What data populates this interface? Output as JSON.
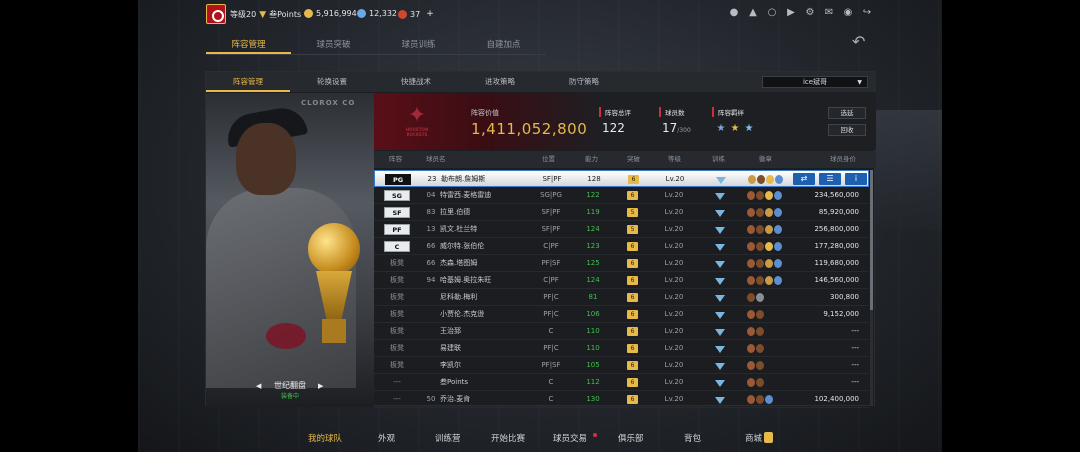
{
  "topbar": {
    "level": "等级20",
    "points_label": "叁Points",
    "gold": "5,916,994",
    "diamonds": "12,332",
    "tickets": "37",
    "plus": "+",
    "icons": [
      "person-icon",
      "bell-icon",
      "friends-icon",
      "video-icon",
      "settings-icon",
      "chat-icon",
      "headset-icon",
      "exit-icon"
    ]
  },
  "main_tabs": [
    "阵容管理",
    "球员突破",
    "球员训练",
    "自建加点"
  ],
  "sub_tabs": [
    "阵容管理",
    "轮换设置",
    "快捷战术",
    "进攻策略",
    "防守策略"
  ],
  "team_select": "ice斌哥",
  "card": {
    "name": "世纪翻盘",
    "status": "装备中",
    "watermark": "CLOROX CO"
  },
  "summary": {
    "value_label": "阵容价值",
    "value": "1,411,052,800",
    "rating_label": "阵容总评",
    "rating": "122",
    "count_label": "球员数",
    "count": "17",
    "count_max": "/300",
    "honor_label": "阵容羁绊",
    "select_button": "选延",
    "recycle_button": "回收",
    "team_logo_text": "HOUSTON ROCKETS"
  },
  "table": {
    "headers": {
      "lineup": "阵容",
      "player": "球员名",
      "position": "位置",
      "ability": "能力",
      "break": "突破",
      "level": "等级",
      "train": "训练",
      "badges": "徽章",
      "salary": "球员身价"
    },
    "rows": [
      {
        "pos": "PG",
        "num": "23",
        "name": "勒布朗.詹姆斯",
        "position": "SF|PF",
        "ability": "128",
        "brk": "6",
        "level": "Lv.20",
        "salary": "",
        "badges": [
          "#c99b45",
          "#7d4c2a",
          "#e6b94a",
          "#5b8fd1"
        ],
        "selected": true,
        "boxed": true
      },
      {
        "pos": "SG",
        "num": "04",
        "name": "特雷西.麦格雷迪",
        "position": "SG|PG",
        "ability": "122",
        "brk": "6",
        "level": "Lv.20",
        "salary": "234,560,000",
        "badges": [
          "#9a5a35",
          "#7d4c2a",
          "#e6b94a",
          "#5b8fd1"
        ],
        "selected": false,
        "boxed": true
      },
      {
        "pos": "SF",
        "num": "83",
        "name": "拉里.伯德",
        "position": "SF|PF",
        "ability": "119",
        "brk": "5",
        "level": "Lv.20",
        "salary": "85,920,000",
        "badges": [
          "#9a5a35",
          "#7d4c2a",
          "#c99b45",
          "#5b8fd1"
        ],
        "selected": false,
        "boxed": true
      },
      {
        "pos": "PF",
        "num": "13",
        "name": "凯文.杜兰特",
        "position": "SF|PF",
        "ability": "124",
        "brk": "5",
        "level": "Lv.20",
        "salary": "256,800,000",
        "badges": [
          "#9a5a35",
          "#7d4c2a",
          "#c99b45",
          "#5b8fd1"
        ],
        "selected": false,
        "boxed": true
      },
      {
        "pos": "C",
        "num": "66",
        "name": "威尔特.张伯伦",
        "position": "C|PF",
        "ability": "123",
        "brk": "6",
        "level": "Lv.20",
        "salary": "177,280,000",
        "badges": [
          "#9a5a35",
          "#7d4c2a",
          "#e6b94a",
          "#5b8fd1"
        ],
        "selected": false,
        "boxed": true
      },
      {
        "pos": "板凳",
        "num": "66",
        "name": "杰森.塔图姆",
        "position": "PF|SF",
        "ability": "125",
        "brk": "6",
        "level": "Lv.20",
        "salary": "119,680,000",
        "badges": [
          "#9a5a35",
          "#7d4c2a",
          "#c99b45",
          "#5b8fd1"
        ],
        "selected": false,
        "boxed": false
      },
      {
        "pos": "板凳",
        "num": "94",
        "name": "哈基姆.奥拉朱旺",
        "position": "C|PF",
        "ability": "124",
        "brk": "6",
        "level": "Lv.20",
        "salary": "146,560,000",
        "badges": [
          "#9a5a35",
          "#7d4c2a",
          "#c99b45",
          "#5b8fd1"
        ],
        "selected": false,
        "boxed": false
      },
      {
        "pos": "板凳",
        "num": "",
        "name": "尼科勒.梅利",
        "position": "PF|C",
        "ability": "81",
        "brk": "6",
        "level": "Lv.20",
        "salary": "300,800",
        "badges": [
          "#7d4c2a",
          "#8b8f95"
        ],
        "selected": false,
        "boxed": false
      },
      {
        "pos": "板凳",
        "num": "",
        "name": "小贾伦.杰克逊",
        "position": "PF|C",
        "ability": "106",
        "brk": "6",
        "level": "Lv.20",
        "salary": "9,152,000",
        "badges": [
          "#9a5a35",
          "#7d4c2a"
        ],
        "selected": false,
        "boxed": false
      },
      {
        "pos": "板凳",
        "num": "",
        "name": "王治郅",
        "position": "C",
        "ability": "110",
        "brk": "6",
        "level": "Lv.20",
        "salary": "---",
        "badges": [
          "#9a5a35",
          "#7d4c2a"
        ],
        "selected": false,
        "boxed": false
      },
      {
        "pos": "板凳",
        "num": "",
        "name": "易建联",
        "position": "PF|C",
        "ability": "110",
        "brk": "6",
        "level": "Lv.20",
        "salary": "---",
        "badges": [
          "#9a5a35",
          "#7d4c2a"
        ],
        "selected": false,
        "boxed": false
      },
      {
        "pos": "板凳",
        "num": "",
        "name": "李凯尔",
        "position": "PF|SF",
        "ability": "105",
        "brk": "6",
        "level": "Lv.20",
        "salary": "---",
        "badges": [
          "#9a5a35",
          "#7d4c2a"
        ],
        "selected": false,
        "boxed": false
      },
      {
        "pos": "---",
        "num": "",
        "name": "叁Points",
        "position": "C",
        "ability": "112",
        "brk": "6",
        "level": "Lv.20",
        "salary": "---",
        "badges": [
          "#9a5a35",
          "#7d4c2a"
        ],
        "selected": false,
        "boxed": false
      },
      {
        "pos": "---",
        "num": "50",
        "name": "乔治.麦肯",
        "position": "C",
        "ability": "130",
        "brk": "6",
        "level": "Lv.20",
        "salary": "102,400,000",
        "badges": [
          "#9a5a35",
          "#7d4c2a",
          "#5b8fd1"
        ],
        "selected": false,
        "boxed": false
      }
    ]
  },
  "bottom_nav": [
    "我的球队",
    "外观",
    "训练营",
    "开始比赛",
    "球员交易",
    "俱乐部",
    "背包",
    "商城"
  ],
  "colors": {
    "accent": "#e6b94a",
    "green": "#3ec24b",
    "selection_blue": "#1f5fb0"
  }
}
